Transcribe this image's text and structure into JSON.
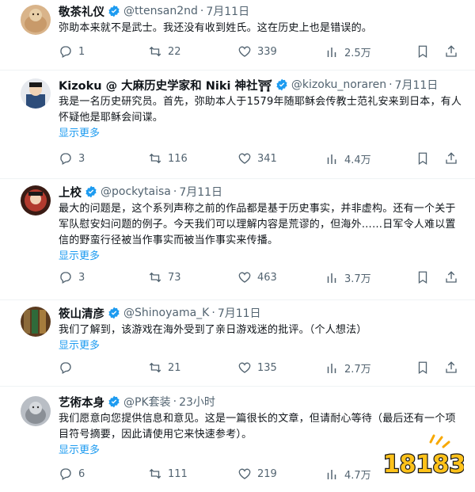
{
  "tweets": [
    {
      "name": "敬茶礼仪",
      "handle": "@ttensan2nd",
      "dot": "·",
      "time": "7月11日",
      "text": "弥助本来就不是武士。我还没有收到姓氏。这在历史上也是错误的。",
      "more": "",
      "replies": "1",
      "retweets": "22",
      "likes": "339",
      "views": "2.5万",
      "avatar_color": "#c89a6a"
    },
    {
      "name": "Kizoku @ 大麻历史学家和 Niki 神社⛩",
      "handle": "@kizoku_noraren",
      "dot": "·",
      "time": "7月11日",
      "text": "我是一名历史研究员。首先，弥助本人于1579年随耶稣会传教士范礼安来到日本，有人怀疑他是耶稣会间谍。",
      "more": "显示更多",
      "replies": "3",
      "retweets": "116",
      "likes": "341",
      "views": "4.4万",
      "avatar_color": "#2d4d7a"
    },
    {
      "name": "上校",
      "handle": "@pockytaisa",
      "dot": "·",
      "time": "7月11日",
      "text": "最大的问题是，这个系列声称之前的作品都是基于历史事实，并非虚构。还有一个关于军队慰安妇问题的例子。今天我们可以理解内容是荒谬的，但海外……日军令人难以置信的野蛮行径被当作事实而被当作事实来传播。",
      "more": "显示更多",
      "replies": "3",
      "retweets": "73",
      "likes": "463",
      "views": "3.7万",
      "avatar_color": "#b23a2e"
    },
    {
      "name": "筱山清彦",
      "handle": "@Shinoyama_K",
      "dot": "·",
      "time": "7月11日",
      "text": "我们了解到，该游戏在海外受到了亲日游戏迷的批评。（个人想法）",
      "more": "显示更多",
      "replies": "",
      "retweets": "21",
      "likes": "135",
      "views": "2.7万",
      "avatar_color": "#6b4a2a"
    },
    {
      "name": "艺術本身",
      "handle": "@PK套装",
      "dot": "·",
      "time": "23小时",
      "text": "我们愿意向您提供信息和意见。这是一篇很长的文章，但请耐心等待（最后还有一个项目符号摘要，因此请使用它来快速参考）。",
      "more": "显示更多",
      "replies": "6",
      "retweets": "111",
      "likes": "219",
      "views": "4.7万",
      "avatar_color": "#8a8f96"
    }
  ],
  "colors": {
    "accent": "#1d9bf0",
    "muted": "#536471",
    "separator": "#eff3f4"
  },
  "icons": [
    "reply-icon",
    "retweet-icon",
    "like-icon",
    "views-icon",
    "bookmark-icon",
    "share-icon",
    "verified-badge-icon"
  ],
  "watermark": {
    "text": "18183"
  }
}
